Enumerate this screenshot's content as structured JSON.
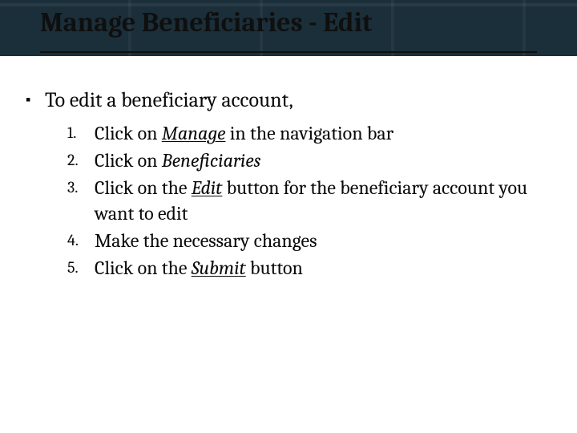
{
  "title": "Manage Beneficiaries - Edit",
  "bullet": {
    "marker": "▪",
    "text": "To edit a beneficiary account,"
  },
  "steps": [
    {
      "pre": "Click on ",
      "em": "Manage",
      "em_underline": true,
      "post": " in the navigation bar"
    },
    {
      "pre": "Click on ",
      "em": "Beneficiaries",
      "em_underline": false,
      "post": ""
    },
    {
      "pre": "Click on the ",
      "em": "Edit",
      "em_underline": true,
      "post": " button for the beneficiary account you want to edit"
    },
    {
      "pre": "Make the necessary changes",
      "em": "",
      "em_underline": false,
      "post": ""
    },
    {
      "pre": "Click on the ",
      "em": "Submit",
      "em_underline": true,
      "post": " button"
    }
  ]
}
